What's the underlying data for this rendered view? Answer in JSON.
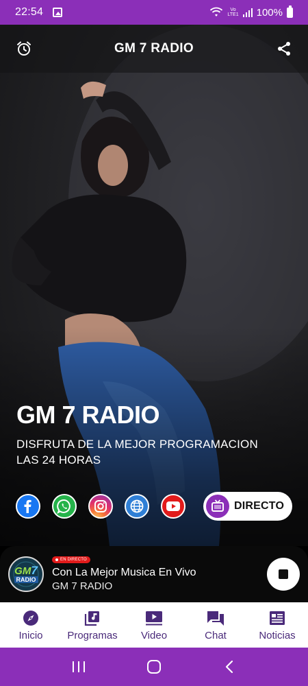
{
  "status_bar": {
    "time": "22:54",
    "network": "Vo LTE1",
    "battery": "100%"
  },
  "app_bar": {
    "title": "GM 7 RADIO",
    "left_icon": "alarm-icon",
    "right_icon": "share-icon"
  },
  "hero": {
    "title": "GM 7 RADIO",
    "subtitle": "DISFRUTA DE LA MEJOR PROGRAMACION LAS 24 HORAS"
  },
  "social": [
    {
      "name": "facebook",
      "icon": "facebook-icon",
      "color": "#1877f2"
    },
    {
      "name": "whatsapp",
      "icon": "whatsapp-icon",
      "color": "#25b34a"
    },
    {
      "name": "instagram",
      "icon": "instagram-icon",
      "color": "#e1306c"
    },
    {
      "name": "website",
      "icon": "globe-icon",
      "color": "#2f7fd6"
    },
    {
      "name": "youtube",
      "icon": "youtube-icon",
      "color": "#e21b1b"
    }
  ],
  "directo_button": {
    "label": "DIRECTO",
    "icon": "tv-icon"
  },
  "player": {
    "logo_text": "GM",
    "logo_number": "7",
    "logo_sub": "RADIO",
    "live_badge": "EN DIRECTO",
    "track_title": "Con La Mejor Musica En Vivo",
    "artist": "GM 7 RADIO",
    "control_icon": "stop-icon"
  },
  "bottom_nav": [
    {
      "label": "Inicio",
      "icon": "compass-icon"
    },
    {
      "label": "Programas",
      "icon": "music-library-icon"
    },
    {
      "label": "Video",
      "icon": "video-play-icon"
    },
    {
      "label": "Chat",
      "icon": "chat-icon"
    },
    {
      "label": "Noticias",
      "icon": "news-icon"
    }
  ],
  "system_nav": [
    "recent-apps-icon",
    "home-icon",
    "back-icon"
  ],
  "colors": {
    "accent": "#8b2fb8",
    "nav_text": "#4a2a7a",
    "live_red": "#e21b1b"
  }
}
